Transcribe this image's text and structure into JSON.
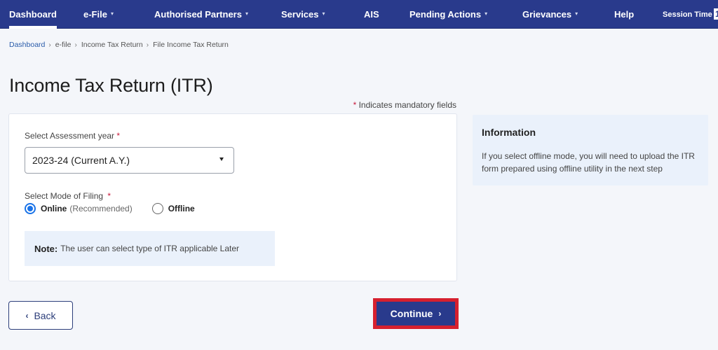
{
  "nav": {
    "items": [
      {
        "label": "Dashboard",
        "dropdown": false,
        "active": true
      },
      {
        "label": "e-File",
        "dropdown": true
      },
      {
        "label": "Authorised Partners",
        "dropdown": true
      },
      {
        "label": "Services",
        "dropdown": true
      },
      {
        "label": "AIS",
        "dropdown": false
      },
      {
        "label": "Pending Actions",
        "dropdown": true
      },
      {
        "label": "Grievances",
        "dropdown": true
      },
      {
        "label": "Help",
        "dropdown": false
      }
    ],
    "session_label": "Session Time",
    "session_value": "1",
    "caret_glyph": "⌄"
  },
  "breadcrumb": {
    "items": [
      "Dashboard",
      "e-file",
      "Income Tax Return",
      "File Income Tax Return"
    ],
    "separator": "›"
  },
  "page": {
    "title": "Income Tax Return (ITR)",
    "mandatory_star": "*",
    "mandatory_text": " Indicates mandatory fields"
  },
  "form": {
    "assessment_year_label": "Select Assessment year",
    "required_star": "*",
    "assessment_year_value": "2023-24 (Current A.Y.)",
    "mode_label": "Select Mode of Filing",
    "modes": [
      {
        "label": "Online",
        "hint": "(Recommended)",
        "checked": true
      },
      {
        "label": "Offline",
        "hint": "",
        "checked": false
      }
    ],
    "note_label": "Note:",
    "note_text": "The user can select type of ITR applicable Later"
  },
  "info": {
    "title": "Information",
    "text": "If you select offline mode, you will need to upload the ITR form prepared using offline utility in the next step"
  },
  "actions": {
    "back_label": "Back",
    "back_icon": "‹",
    "continue_label": "Continue",
    "continue_icon": "›"
  },
  "colors": {
    "nav_bg": "#293a8c",
    "primary": "#293a8c",
    "highlight_border": "#d6202f",
    "required": "#c81a3c",
    "radio_checked": "#1a73e8",
    "info_bg": "#eaf1fb",
    "link": "#2a5caa"
  }
}
